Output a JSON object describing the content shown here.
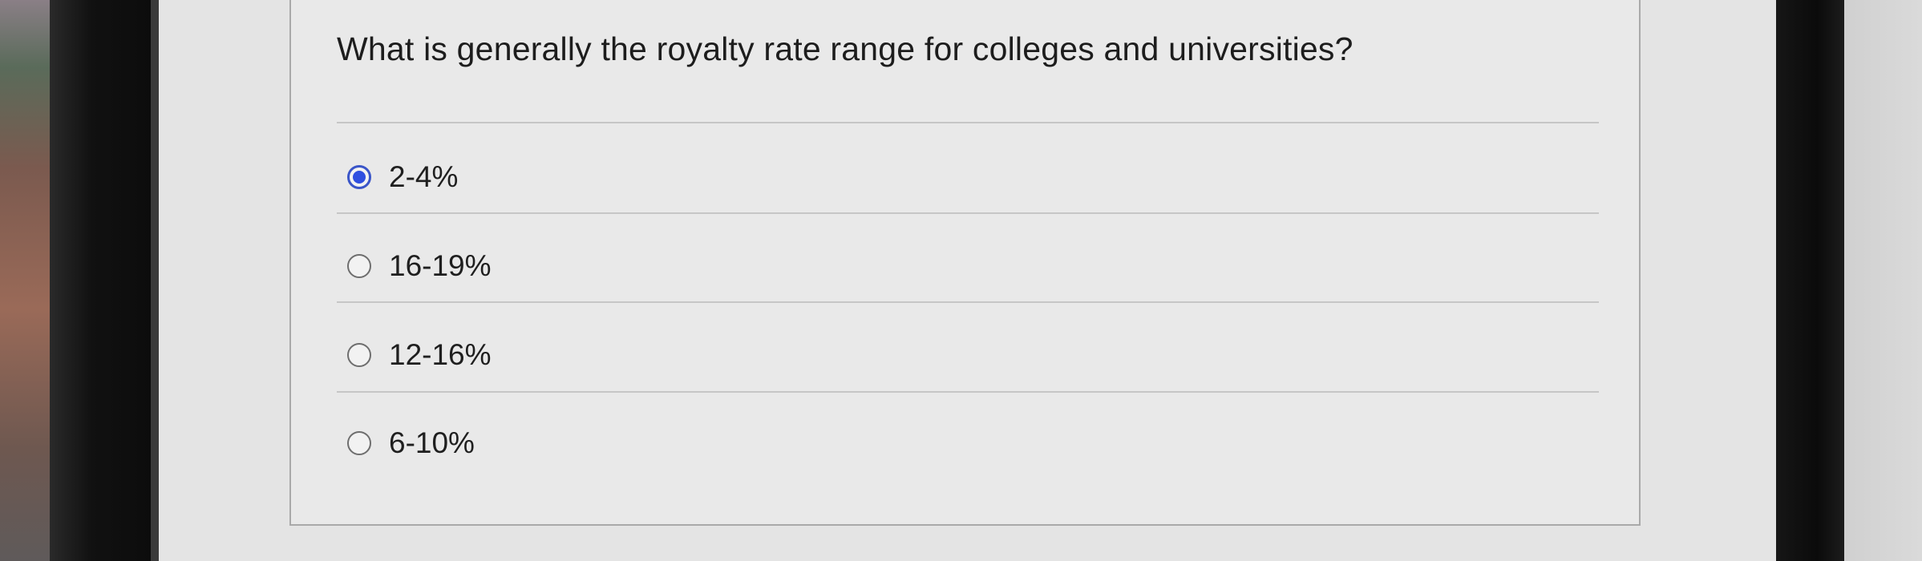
{
  "quiz": {
    "question": "What is generally the royalty rate range for colleges and universities?",
    "options": [
      {
        "label": "2-4%",
        "selected": true
      },
      {
        "label": "16-19%",
        "selected": false
      },
      {
        "label": "12-16%",
        "selected": false
      },
      {
        "label": "6-10%",
        "selected": false
      }
    ]
  },
  "colors": {
    "selected_radio": "#2f4fe0",
    "text": "#1f1f1f",
    "divider": "#c6c6c6"
  }
}
